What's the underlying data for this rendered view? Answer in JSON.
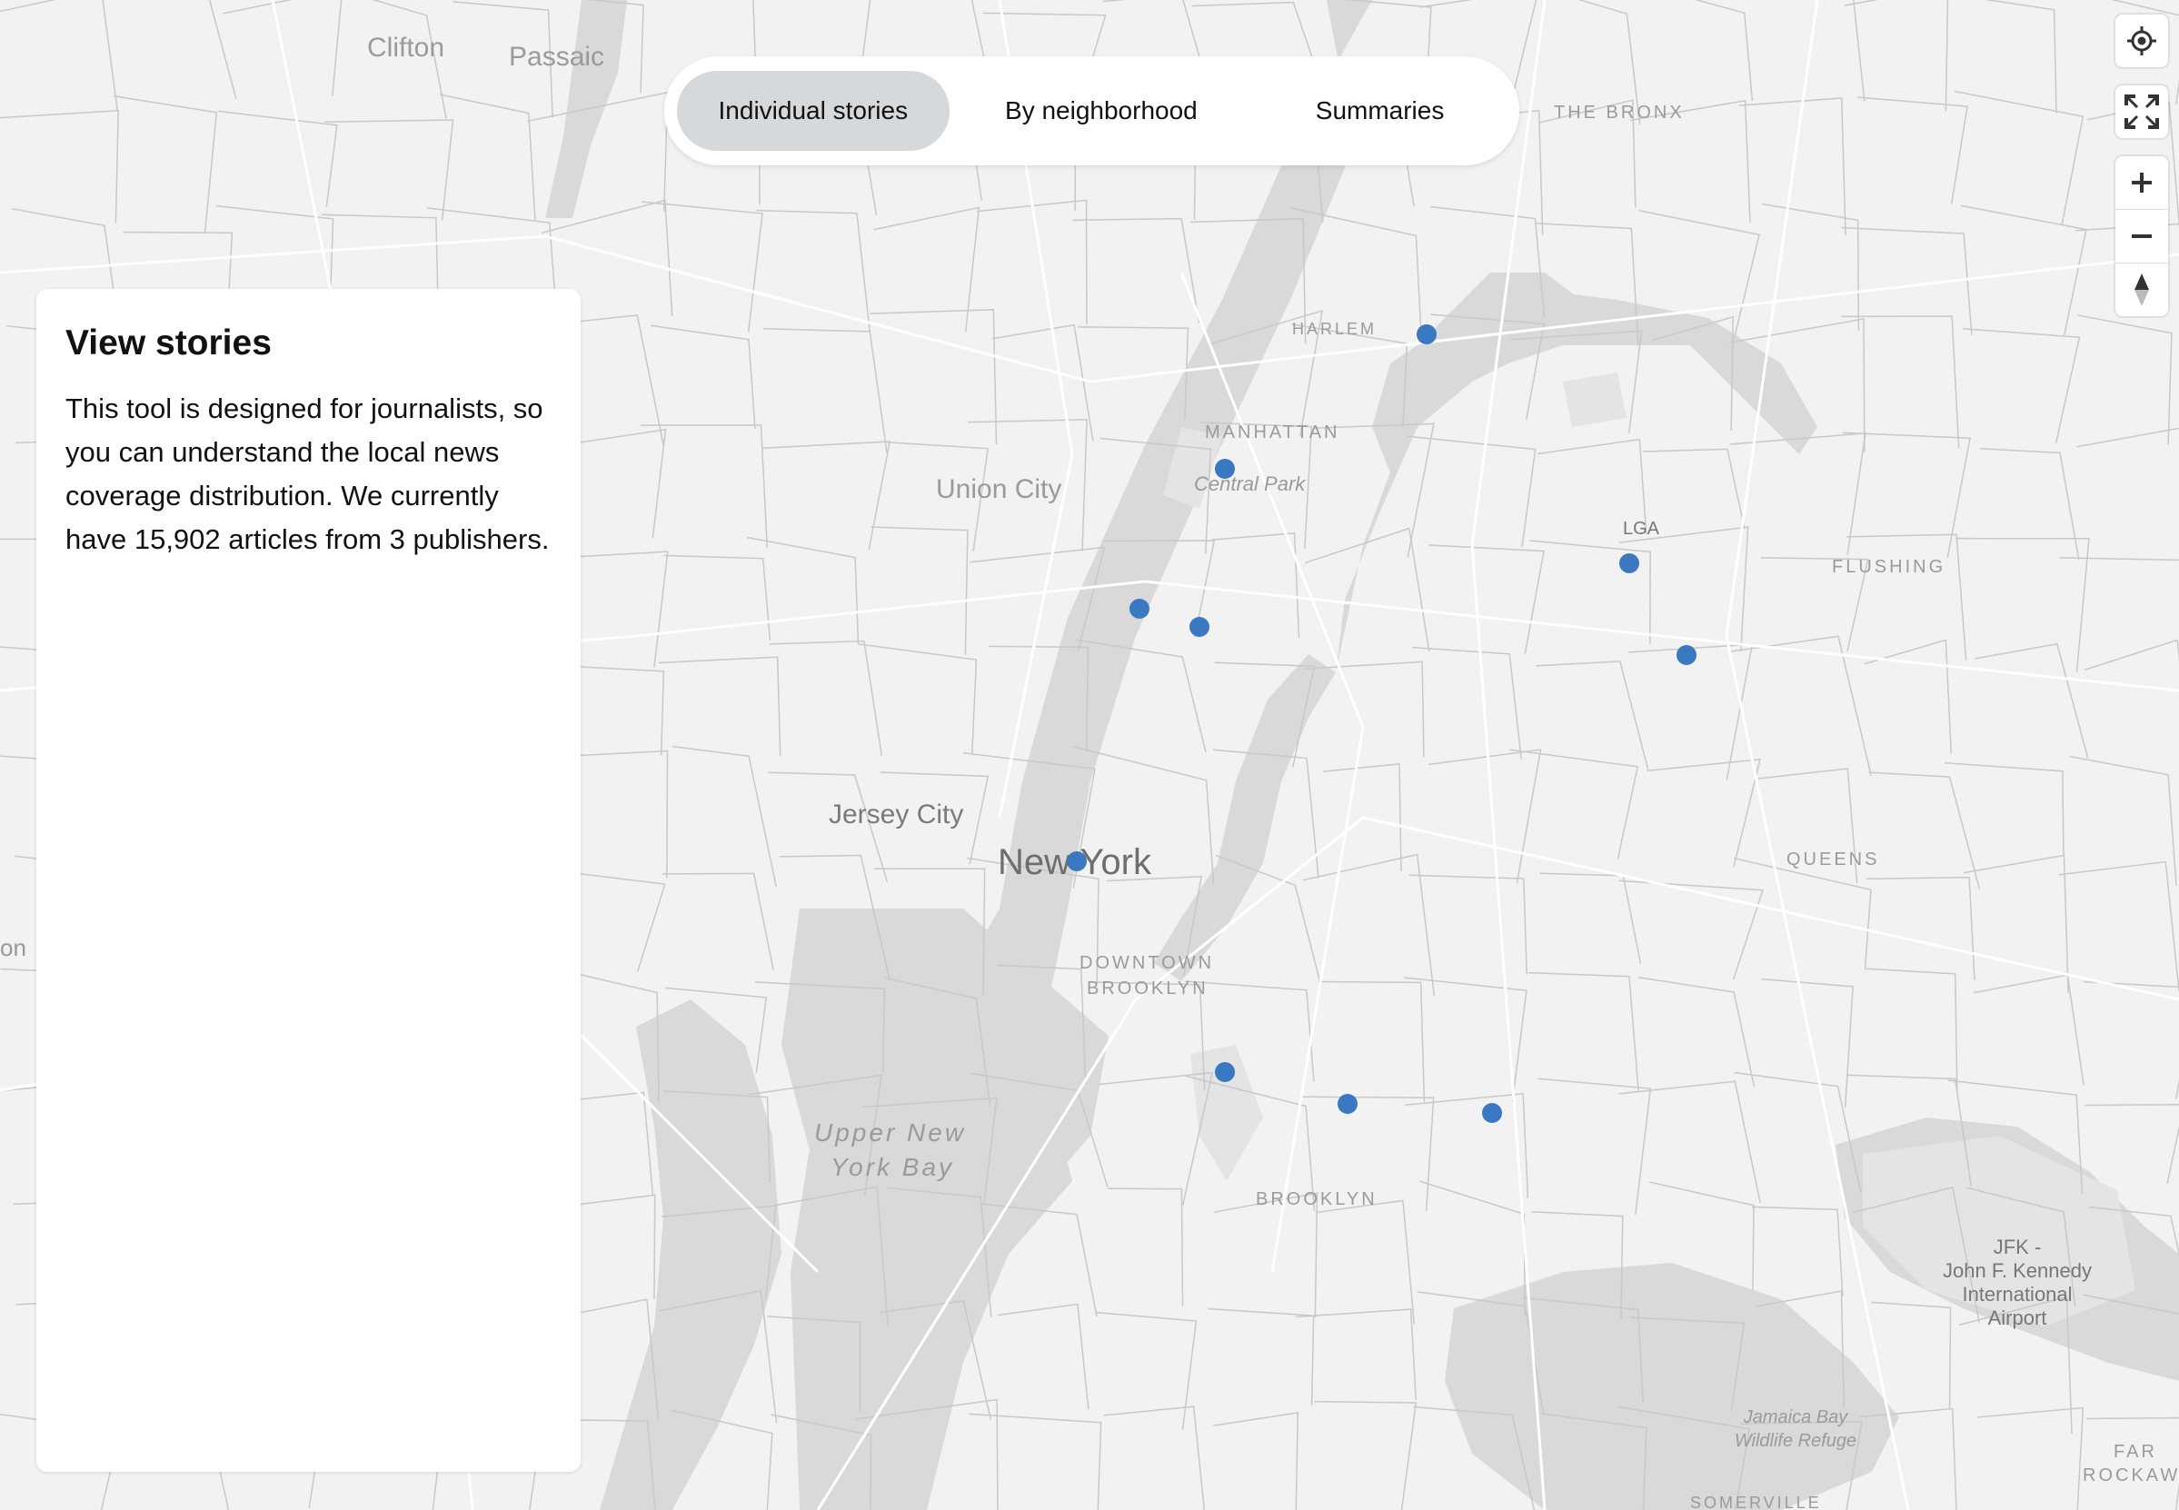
{
  "tabs": [
    {
      "label": "Individual stories",
      "active": true
    },
    {
      "label": "By neighborhood",
      "active": false
    },
    {
      "label": "Summaries",
      "active": false
    }
  ],
  "panel": {
    "title": "View stories",
    "description": "This tool is designed for journalists, so you can understand the local news coverage distribution. We currently have 15,902 articles from 3 publishers."
  },
  "map": {
    "labels": {
      "clifton": "Clifton",
      "passaic": "Passaic",
      "the_bronx": "THE BRONX",
      "harlem": "HARLEM",
      "manhattan": "MANHATTAN",
      "central_park": "Central Park",
      "union_city": "Union City",
      "lga": "LGA",
      "flushing": "FLUSHING",
      "jersey_city": "Jersey City",
      "new_york": "New York",
      "queens": "QUEENS",
      "downtown": "DOWNTOWN",
      "brooklyn_small": "BROOKLYN",
      "upper_ny_bay_1": "Upper New",
      "upper_ny_bay_2": "York Bay",
      "brooklyn": "BROOKLYN",
      "jfk_1": "JFK -",
      "jfk_2": "John F. Kennedy",
      "jfk_3": "International",
      "jfk_4": "Airport",
      "jamaica_1": "Jamaica Bay",
      "jamaica_2": "Wildlife Refuge",
      "far_1": "FAR",
      "far_2": "ROCKAW",
      "somerville": "SOMERVILLE",
      "on": "on"
    },
    "marker_color": "#3b78c2",
    "water_color": "#d9d9d9",
    "land_color": "#f2f2f2"
  },
  "controls": [
    {
      "name": "geolocate-button",
      "icon": "target-icon"
    },
    {
      "name": "fullscreen-button",
      "icon": "fullscreen-icon"
    },
    {
      "name": "zoom-in-button",
      "icon": "plus-icon"
    },
    {
      "name": "zoom-out-button",
      "icon": "minus-icon"
    },
    {
      "name": "compass-button",
      "icon": "compass-icon"
    }
  ]
}
